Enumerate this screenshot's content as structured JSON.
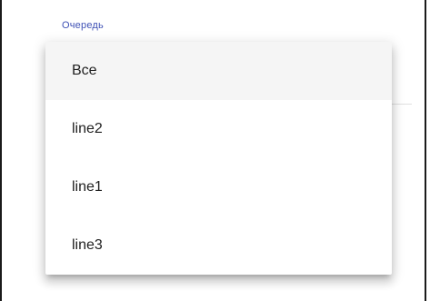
{
  "field": {
    "label": "Очередь"
  },
  "menu": {
    "items": [
      {
        "label": "Все",
        "selected": true
      },
      {
        "label": "line2",
        "selected": false
      },
      {
        "label": "line1",
        "selected": false
      },
      {
        "label": "line3",
        "selected": false
      }
    ]
  },
  "colors": {
    "label": "#3f51b5",
    "selected_bg": "#f5f5f5",
    "text": "#212121",
    "border": "#1a1a1a"
  }
}
